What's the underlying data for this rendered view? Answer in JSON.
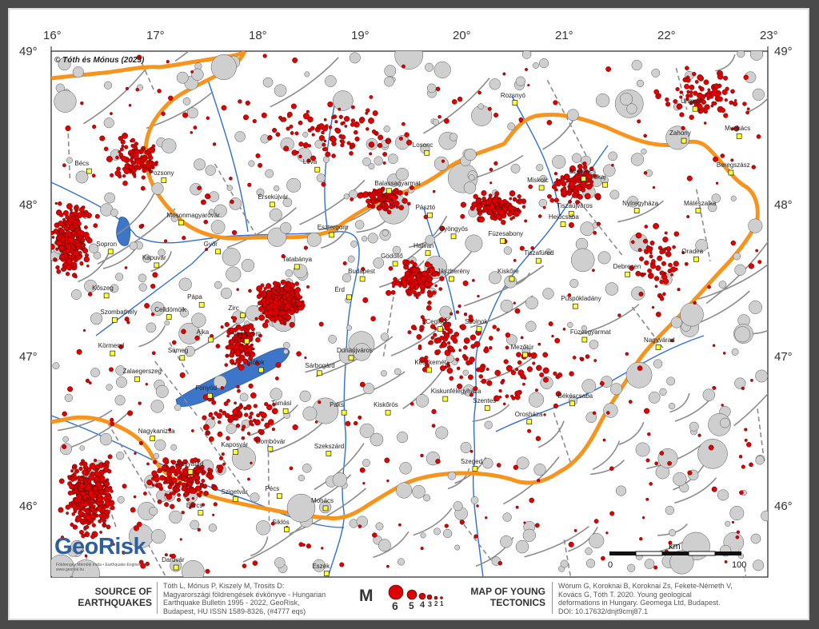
{
  "map": {
    "copyright": "© Tóth és Mónus (2023)",
    "lon_labels": [
      "16°",
      "17°",
      "18°",
      "19°",
      "20°",
      "21°",
      "22°",
      "23°"
    ],
    "lat_labels": [
      "49°",
      "48°",
      "47°",
      "46°"
    ],
    "scale": {
      "unit": "km",
      "zero": "0",
      "max": "100"
    },
    "colors": {
      "border": "#f7941d",
      "quake": "#e00000",
      "river": "#2f6fd6",
      "lake": "#3d76c9",
      "fault": "#808080",
      "town": "#ffff33"
    }
  },
  "towns": [
    {
      "name": "Rozsnyó",
      "lon": 20.53,
      "lat": 48.66
    },
    {
      "name": "Losonc",
      "lon": 19.67,
      "lat": 48.33
    },
    {
      "name": "Léva",
      "lon": 18.6,
      "lat": 48.22
    },
    {
      "name": "Pozsony",
      "lon": 17.1,
      "lat": 48.15
    },
    {
      "name": "Bécs",
      "lon": 16.37,
      "lat": 48.21
    },
    {
      "name": "Érsekújvár",
      "lon": 18.16,
      "lat": 47.99
    },
    {
      "name": "Balassagyarmat",
      "lon": 19.3,
      "lat": 48.08
    },
    {
      "name": "Miskolc",
      "lon": 20.79,
      "lat": 48.1
    },
    {
      "name": "Szerencs",
      "lon": 21.2,
      "lat": 48.16
    },
    {
      "name": "Ungvár",
      "lon": 22.29,
      "lat": 48.62
    },
    {
      "name": "Munkács",
      "lon": 22.72,
      "lat": 48.44
    },
    {
      "name": "Zahony",
      "lon": 22.18,
      "lat": 48.41
    },
    {
      "name": "Beregszász",
      "lon": 22.64,
      "lat": 48.2
    },
    {
      "name": "Tokaj",
      "lon": 21.41,
      "lat": 48.12
    },
    {
      "name": "Tiszaújváros",
      "lon": 21.08,
      "lat": 47.93
    },
    {
      "name": "Nyíregyháza",
      "lon": 21.72,
      "lat": 47.95
    },
    {
      "name": "Mátészalka",
      "lon": 22.32,
      "lat": 47.95
    },
    {
      "name": "Hejőcsaba",
      "lon": 21.0,
      "lat": 47.86
    },
    {
      "name": "Pásztó",
      "lon": 19.7,
      "lat": 47.92
    },
    {
      "name": "Gyöngyös",
      "lon": 19.93,
      "lat": 47.78
    },
    {
      "name": "Mosonmagyaróvár",
      "lon": 17.27,
      "lat": 47.87
    },
    {
      "name": "Esztergom",
      "lon": 18.74,
      "lat": 47.79
    },
    {
      "name": "Győr",
      "lon": 17.63,
      "lat": 47.68
    },
    {
      "name": "Tatabánya",
      "lon": 18.4,
      "lat": 47.58
    },
    {
      "name": "Gödöllő",
      "lon": 19.36,
      "lat": 47.6
    },
    {
      "name": "Hatvan",
      "lon": 19.68,
      "lat": 47.67
    },
    {
      "name": "Sopron",
      "lon": 16.58,
      "lat": 47.68
    },
    {
      "name": "Kapuvár",
      "lon": 17.03,
      "lat": 47.59
    },
    {
      "name": "Tiszafüred",
      "lon": 20.76,
      "lat": 47.62
    },
    {
      "name": "Füzesabony",
      "lon": 20.41,
      "lat": 47.75
    },
    {
      "name": "Budapest",
      "lon": 19.04,
      "lat": 47.5
    },
    {
      "name": "Jászberény",
      "lon": 19.91,
      "lat": 47.5
    },
    {
      "name": "Kiskőre",
      "lon": 20.5,
      "lat": 47.5
    },
    {
      "name": "Debrecen",
      "lon": 21.63,
      "lat": 47.53
    },
    {
      "name": "Oradea",
      "lon": 22.3,
      "lat": 47.63
    },
    {
      "name": "Kőszeg",
      "lon": 16.54,
      "lat": 47.39
    },
    {
      "name": "Celldömölk",
      "lon": 17.15,
      "lat": 47.25
    },
    {
      "name": "Pápa",
      "lon": 17.47,
      "lat": 47.33
    },
    {
      "name": "Zirc",
      "lon": 17.87,
      "lat": 47.26
    },
    {
      "name": "Érd",
      "lon": 18.91,
      "lat": 47.38
    },
    {
      "name": "Püspökladány",
      "lon": 21.12,
      "lat": 47.32
    },
    {
      "name": "Szombathely",
      "lon": 16.62,
      "lat": 47.23
    },
    {
      "name": "Ajka",
      "lon": 17.56,
      "lat": 47.1
    },
    {
      "name": "Veszprém",
      "lon": 17.91,
      "lat": 47.09
    },
    {
      "name": "Cegléd",
      "lon": 19.8,
      "lat": 47.17
    },
    {
      "name": "Szolnok",
      "lon": 20.18,
      "lat": 47.17
    },
    {
      "name": "Füzesgyarmat",
      "lon": 21.21,
      "lat": 47.1
    },
    {
      "name": "Nagyvárad",
      "lon": 21.93,
      "lat": 47.05
    },
    {
      "name": "Körmend",
      "lon": 16.6,
      "lat": 47.01
    },
    {
      "name": "Sümeg",
      "lon": 17.28,
      "lat": 46.98
    },
    {
      "name": "Dunaújváros",
      "lon": 18.93,
      "lat": 46.98
    },
    {
      "name": "Mezőtúr",
      "lon": 20.63,
      "lat": 47.0
    },
    {
      "name": "Siófok",
      "lon": 18.05,
      "lat": 46.9
    },
    {
      "name": "Kecskemét",
      "lon": 19.69,
      "lat": 46.9
    },
    {
      "name": "Zalaegerszeg",
      "lon": 16.84,
      "lat": 46.84
    },
    {
      "name": "Sárbogárd",
      "lon": 18.62,
      "lat": 46.88
    },
    {
      "name": "Fonyód",
      "lon": 17.55,
      "lat": 46.73
    },
    {
      "name": "Kiskunfélegyháza",
      "lon": 19.85,
      "lat": 46.71
    },
    {
      "name": "Békéscsaba",
      "lon": 21.09,
      "lat": 46.68
    },
    {
      "name": "Paks",
      "lon": 18.86,
      "lat": 46.62
    },
    {
      "name": "Tamási",
      "lon": 18.29,
      "lat": 46.63
    },
    {
      "name": "Kiskőrös",
      "lon": 19.29,
      "lat": 46.62
    },
    {
      "name": "Szentes",
      "lon": 20.26,
      "lat": 46.65
    },
    {
      "name": "Orosháza",
      "lon": 20.67,
      "lat": 46.56
    },
    {
      "name": "Nagykanizsa",
      "lon": 16.99,
      "lat": 46.45
    },
    {
      "name": "Dombóvár",
      "lon": 18.14,
      "lat": 46.38
    },
    {
      "name": "Kaposvár",
      "lon": 17.8,
      "lat": 46.36
    },
    {
      "name": "Szekszárd",
      "lon": 18.71,
      "lat": 46.35
    },
    {
      "name": "Szeged",
      "lon": 20.14,
      "lat": 46.25
    },
    {
      "name": "Nagyatád",
      "lon": 17.36,
      "lat": 46.23
    },
    {
      "name": "Szigetvár",
      "lon": 17.8,
      "lat": 46.05
    },
    {
      "name": "Pécs",
      "lon": 18.23,
      "lat": 46.07
    },
    {
      "name": "Mohács",
      "lon": 18.68,
      "lat": 45.99
    },
    {
      "name": "Barcs",
      "lon": 17.46,
      "lat": 45.96
    },
    {
      "name": "Siklós",
      "lon": 18.3,
      "lat": 45.85
    },
    {
      "name": "Daruvár",
      "lon": 17.22,
      "lat": 45.6
    },
    {
      "name": "Eszék",
      "lon": 18.69,
      "lat": 45.56
    }
  ],
  "legend": {
    "source_title": [
      "SOURCE OF",
      "EARTHQUAKES"
    ],
    "source_text": [
      "Tóth L, Mónus P, Kiszely M, Trosits D:",
      "Magyarországi földrengések évkönyve - Hungarian",
      "Earthquake Bulletin 1995 - 2022, GeoRisk,",
      "Budapest, HU ISSN 1589-8326, (#4777 eqs)"
    ],
    "m_label": "M",
    "magnitudes": [
      "6",
      "5",
      "4",
      "3",
      "2",
      "1"
    ],
    "tectonics_title": [
      "MAP OF YOUNG",
      "TECTONICS"
    ],
    "tectonics_text": [
      "Wórum G, Koroknai B, Koroknai Zs, Fekete-Németh V,",
      "Kovács G, Tóth T. 2020. Young geological",
      "deformations in Hungary. Geomega Ltd, Budapest.",
      "DOI: 10.17632/dnjt9cmj87.1"
    ]
  },
  "logo": {
    "name": "GeoRisk",
    "subtitle": "Földrengés Mérnöki Iroda • Earthquake Engineering",
    "url": "www.georisk.hu"
  }
}
